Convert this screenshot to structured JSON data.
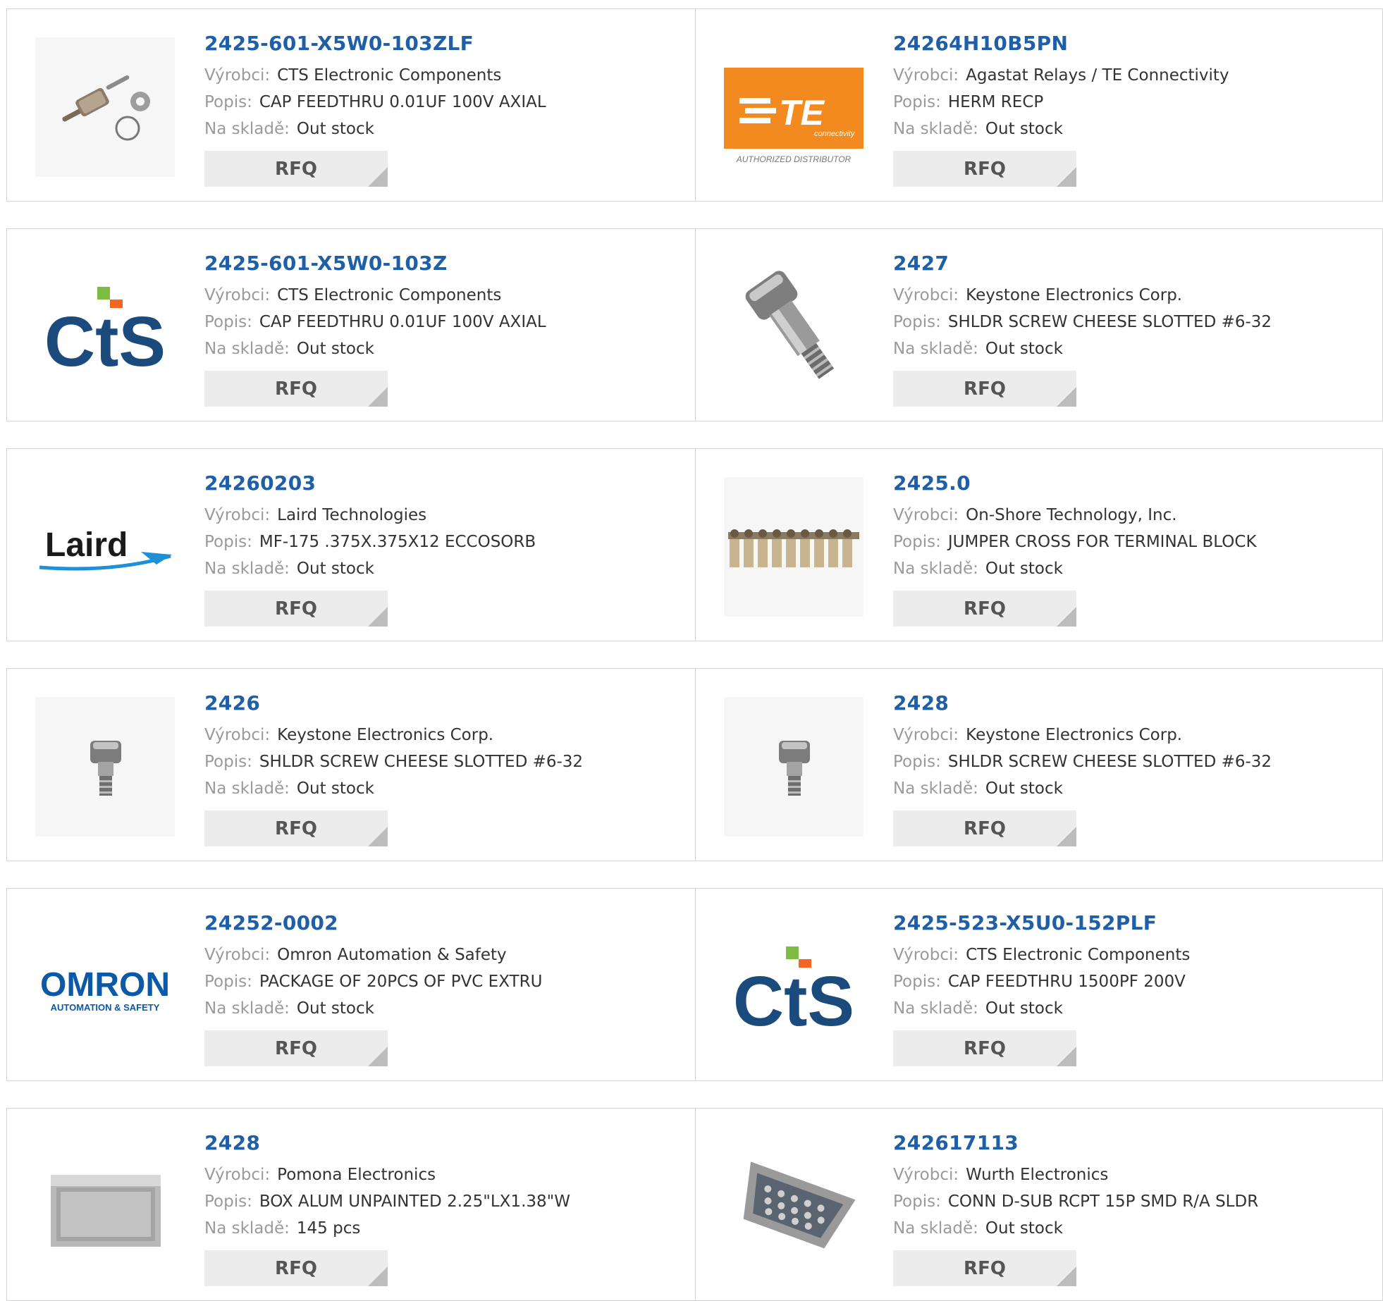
{
  "labels": {
    "manufacturer": "Výrobci:",
    "description": "Popis:",
    "stock": "Na skladě:",
    "rfq": "RFQ"
  },
  "logos": {
    "te_text": "TE",
    "te_sub": "connectivity",
    "te_caption": "AUTHORIZED DISTRIBUTOR",
    "cts_text": "CtS",
    "laird_text": "Laird",
    "omron_text": "OMRON",
    "omron_sub": "AUTOMATION & SAFETY"
  },
  "colors": {
    "part_link": "#1f5fa8",
    "te_orange": "#f28a20",
    "cts_blue": "#1b4b7c",
    "cts_green": "#7dbb42",
    "cts_orange": "#f26522",
    "omron_blue": "#0a5aa8"
  },
  "products": [
    {
      "part": "2425-601-X5W0-103ZLF",
      "manufacturer": "CTS Electronic Components",
      "description": "CAP FEEDTHRU 0.01UF 100V AXIAL",
      "stock": "Out stock",
      "image": "feedthru-capacitor-image"
    },
    {
      "part": "24264H10B5PN",
      "manufacturer": "Agastat Relays / TE Connectivity",
      "description": "HERM RECP",
      "stock": "Out stock",
      "image": "te-connectivity-logo"
    },
    {
      "part": "2425-601-X5W0-103Z",
      "manufacturer": "CTS Electronic Components",
      "description": "CAP FEEDTHRU 0.01UF 100V AXIAL",
      "stock": "Out stock",
      "image": "cts-logo"
    },
    {
      "part": "2427",
      "manufacturer": "Keystone Electronics Corp.",
      "description": "SHLDR SCREW CHEESE SLOTTED #6-32",
      "stock": "Out stock",
      "image": "shoulder-screw-image"
    },
    {
      "part": "24260203",
      "manufacturer": "Laird Technologies",
      "description": "MF-175 .375X.375X12 ECCOSORB",
      "stock": "Out stock",
      "image": "laird-logo"
    },
    {
      "part": "2425.0",
      "manufacturer": "On-Shore Technology, Inc.",
      "description": "JUMPER CROSS FOR TERMINAL BLOCK",
      "stock": "Out stock",
      "image": "jumper-strip-image"
    },
    {
      "part": "2426",
      "manufacturer": "Keystone Electronics Corp.",
      "description": "SHLDR SCREW CHEESE SLOTTED #6-32",
      "stock": "Out stock",
      "image": "small-screw-image"
    },
    {
      "part": "2428",
      "manufacturer": "Keystone Electronics Corp.",
      "description": "SHLDR SCREW CHEESE SLOTTED #6-32",
      "stock": "Out stock",
      "image": "small-screw-image"
    },
    {
      "part": "24252-0002",
      "manufacturer": "Omron Automation & Safety",
      "description": "PACKAGE OF 20PCS OF PVC EXTRU",
      "stock": "Out stock",
      "image": "omron-logo"
    },
    {
      "part": "2425-523-X5U0-152PLF",
      "manufacturer": "CTS Electronic Components",
      "description": "CAP FEEDTHRU 1500PF 200V",
      "stock": "Out stock",
      "image": "cts-logo"
    },
    {
      "part": "2428",
      "manufacturer": "Pomona Electronics",
      "description": "BOX ALUM UNPAINTED 2.25\"LX1.38\"W",
      "stock": "145 pcs",
      "image": "aluminum-box-image"
    },
    {
      "part": "242617113",
      "manufacturer": "Wurth Electronics",
      "description": "CONN D-SUB RCPT 15P SMD R/A SLDR",
      "stock": "Out stock",
      "image": "dsub-connector-image"
    }
  ]
}
